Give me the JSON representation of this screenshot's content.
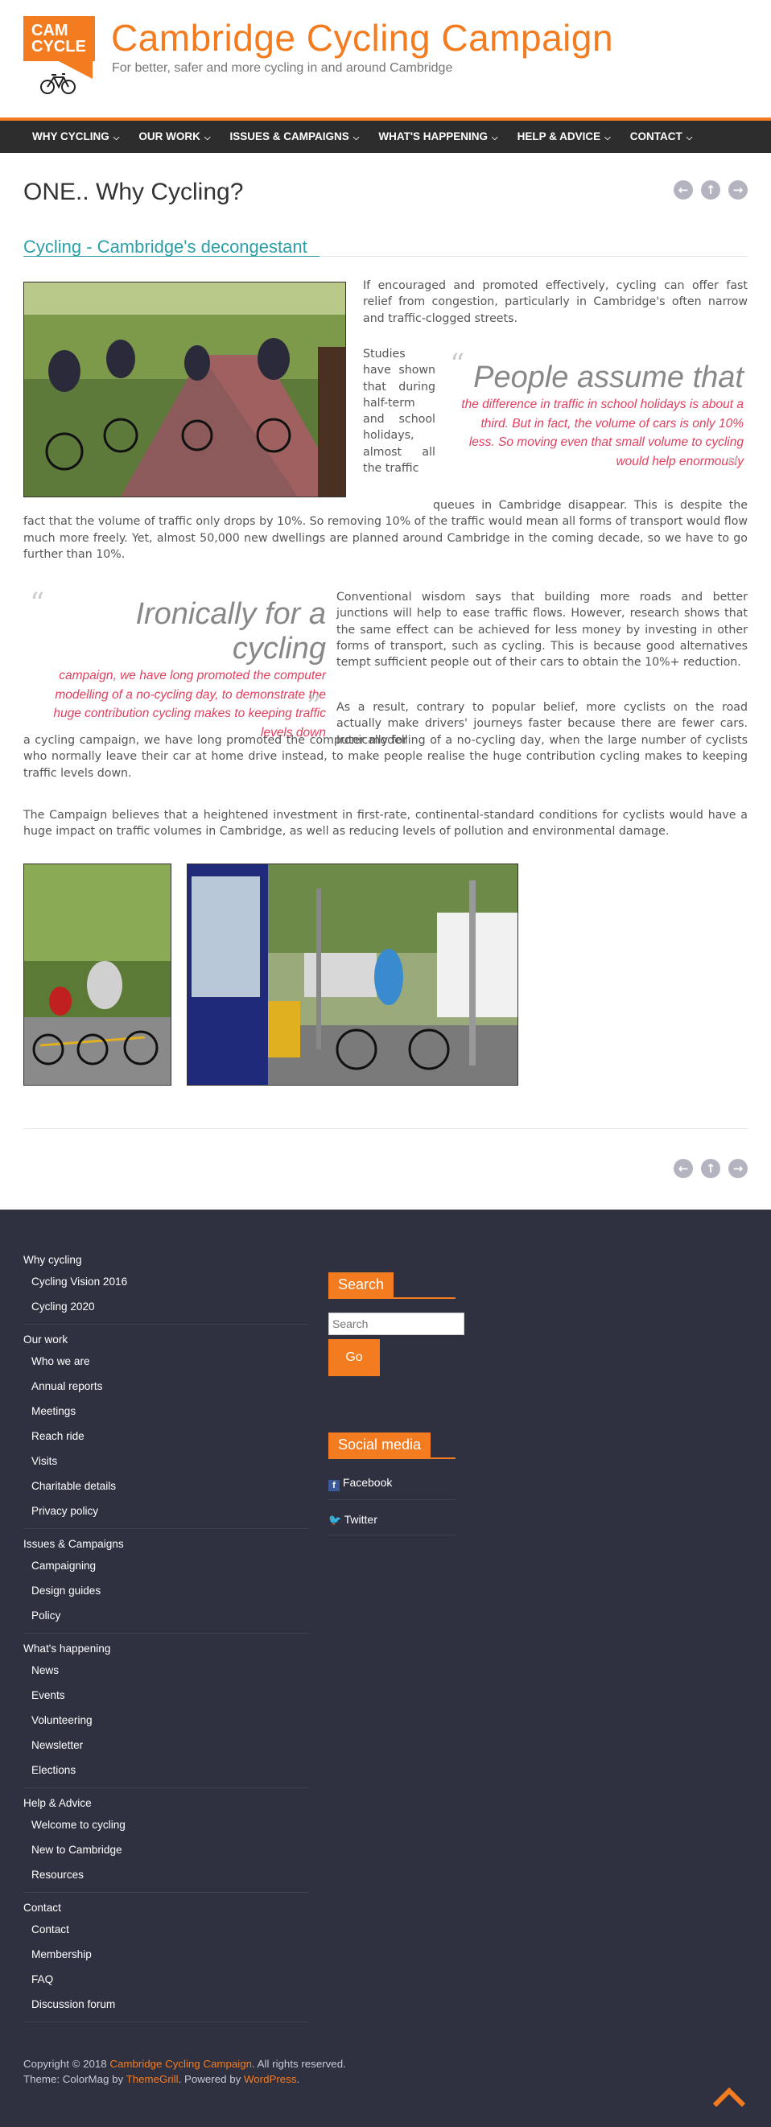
{
  "header": {
    "logo_line1": "CAM",
    "logo_line2": "CYCLE",
    "site_title": "Cambridge Cycling Campaign",
    "site_description": "For better, safer and more cycling in and around Cambridge"
  },
  "nav": {
    "items": [
      {
        "label": "WHY CYCLING"
      },
      {
        "label": "OUR WORK"
      },
      {
        "label": "ISSUES & CAMPAIGNS"
      },
      {
        "label": "WHAT'S HAPPENING"
      },
      {
        "label": "HELP & ADVICE"
      },
      {
        "label": "CONTACT"
      }
    ]
  },
  "article": {
    "title": "ONE.. Why Cycling?",
    "subheading": "Cycling - Cambridge's decongestant",
    "intro": "If encouraged and promoted effectively, cycling can offer fast relief from congestion, particularly in Cambridge's often narrow and traffic-clogged streets.",
    "studies_start": "Studies have shown that during half-term and school holidays, almost all the traffic",
    "studies_cont": "queues in Cambridge disappear. This is despite the fact that the volume of traffic only drops by 10%. So removing 10% of the traffic would mean all forms of transport would flow much more freely. Yet, almost 50,000 new dwellings are planned around Cambridge in the coming decade, so we have to go further than 10%.",
    "pullquote1_lead": "People assume that",
    "pullquote1_rest": "the difference in traffic in school holidays is about a third. But in fact, the volume of cars is only 10% less. So moving even that small volume to cycling would help enormously",
    "conventional": "Conventional wisdom says that building more roads and better junctions will help to ease traffic flows. However, research shows that the same effect can be achieved for less money by investing in other forms of transport, such as cycling. This is because good alternatives tempt sufficient people out of their cars to obtain the 10%+ reduction.",
    "pullquote2_lead": "Ironically for a cycling",
    "pullquote2_rest": "campaign, we have long promoted the computer modelling of a no-cycling day, to demonstrate the huge contribution cycling makes to keeping traffic levels down",
    "result_start": "As a result, contrary to popular belief, more cyclists on the road actually make drivers' journeys faster because there are fewer cars. Ironically for",
    "result_cont": "a cycling campaign, we have long promoted the computer modelling of a no-cycling day, when the large number of cyclists who normally leave their car at home drive instead, to make people realise the huge contribution cycling makes to keeping traffic levels down.",
    "campaign_belief": "The Campaign believes that a heightened investment in first-rate, continental-standard conditions for cyclists would have a huge impact on traffic volumes in Cambridge, as well as reducing levels of pollution and environmental damage."
  },
  "footer": {
    "menu": [
      {
        "heading": "Why cycling",
        "items": [
          "Cycling Vision 2016",
          "Cycling 2020"
        ]
      },
      {
        "heading": "Our work",
        "items": [
          "Who we are",
          "Annual reports",
          "Meetings",
          "Reach ride",
          "Visits",
          "Charitable details",
          "Privacy policy"
        ]
      },
      {
        "heading": "Issues & Campaigns",
        "items": [
          "Campaigning",
          "Design guides",
          "Policy"
        ]
      },
      {
        "heading": "What's happening",
        "items": [
          "News",
          "Events",
          "Volunteering",
          "Newsletter",
          "Elections"
        ]
      },
      {
        "heading": "Help & Advice",
        "items": [
          "Welcome to cycling",
          "New to Cambridge",
          "Resources"
        ]
      },
      {
        "heading": "Contact",
        "items": [
          "Contact",
          "Membership",
          "FAQ",
          "Discussion forum"
        ]
      }
    ],
    "search_title": "Search",
    "search_placeholder": "Search",
    "go_label": "Go",
    "social_title": "Social media",
    "facebook_label": "Facebook",
    "twitter_label": "Twitter",
    "copyright_prefix": "Copyright © 2018 ",
    "copyright_link": "Cambridge Cycling Campaign",
    "copyright_suffix": ". All rights reserved.",
    "theme_prefix": "Theme: ColorMag by ",
    "theme_link": "ThemeGrill",
    "powered_prefix": ". Powered by ",
    "powered_link": "WordPress",
    "powered_suffix": "."
  },
  "colors": {
    "brand_orange": "#f47c20",
    "teal": "#2aa0a8",
    "pullquote_red": "#e0405e",
    "nav_bg": "#2d2d2d",
    "footer_bg": "#2f3140"
  }
}
